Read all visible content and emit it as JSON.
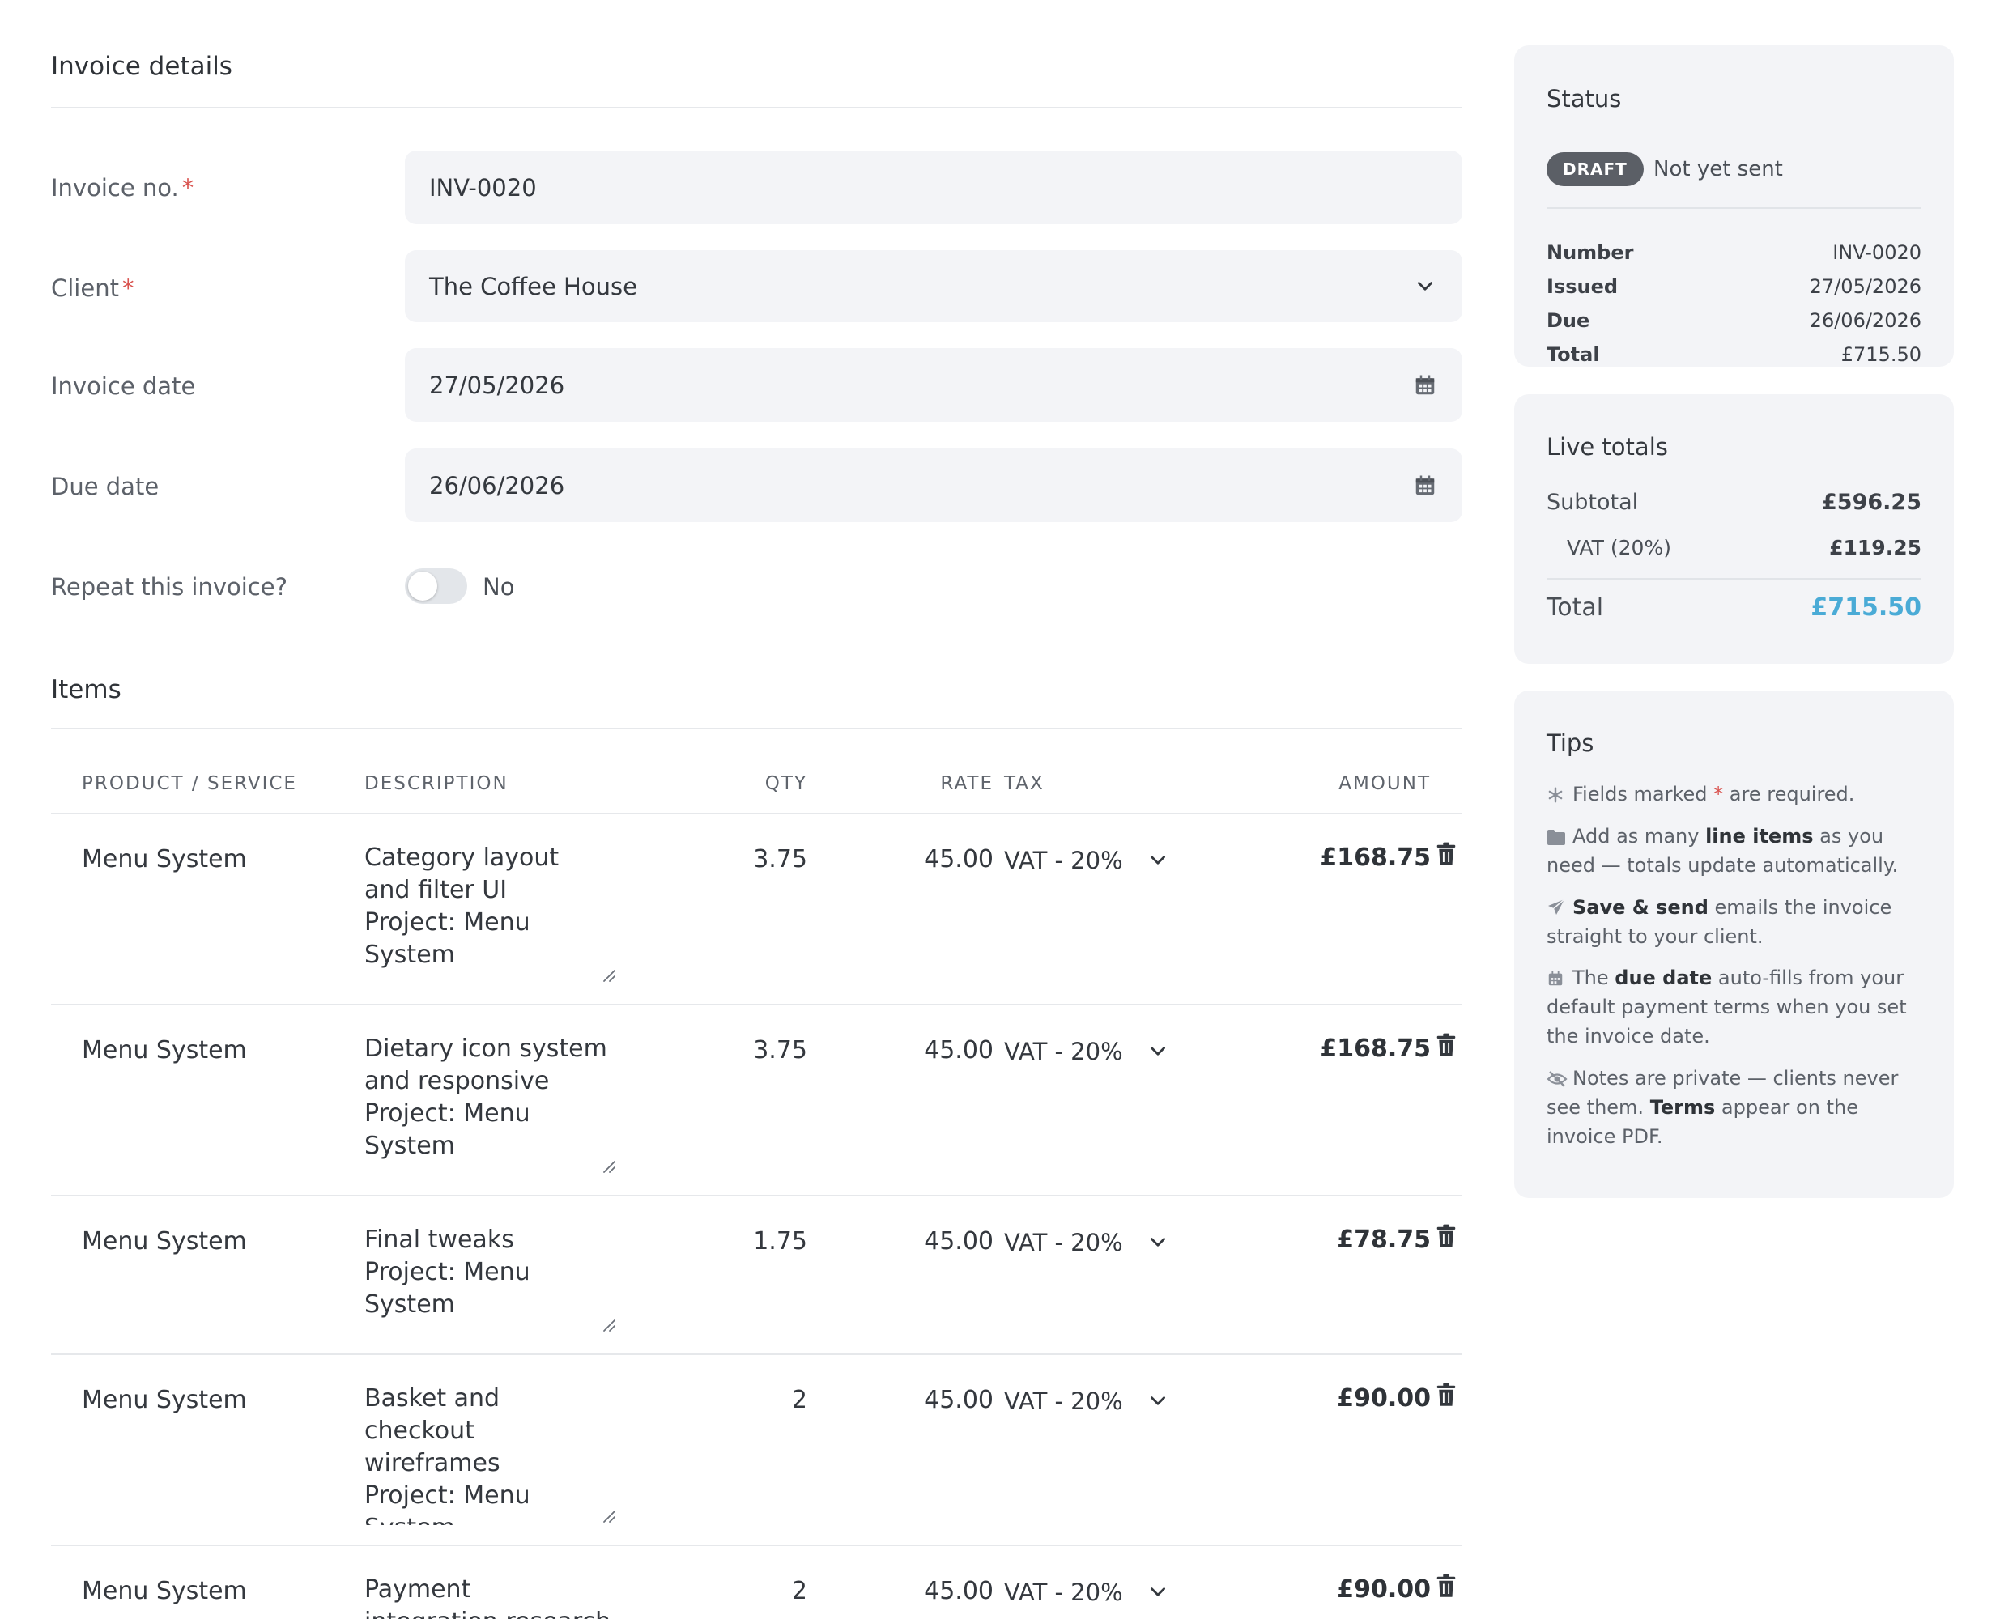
{
  "form": {
    "section_title": "Invoice details",
    "invoice_no": {
      "label": "Invoice no.",
      "required": "*",
      "value": "INV-0020"
    },
    "client": {
      "label": "Client",
      "required": "*",
      "value": "The Coffee House"
    },
    "invoice_date": {
      "label": "Invoice date",
      "value": "27/05/2026"
    },
    "due_date": {
      "label": "Due date",
      "value": "26/06/2026"
    },
    "repeat": {
      "label": "Repeat this invoice?",
      "value": "No"
    }
  },
  "items": {
    "section_title": "Items",
    "headers": {
      "product": "PRODUCT / SERVICE",
      "description": "DESCRIPTION",
      "qty": "QTY",
      "rate": "RATE",
      "tax": "TAX",
      "amount": "AMOUNT"
    },
    "rows": [
      {
        "product": "Menu System",
        "description": "Category layout and filter UI\nProject: Menu System",
        "qty": "3.75",
        "rate": "45.00",
        "tax": "VAT - 20%",
        "amount": "£168.75"
      },
      {
        "product": "Menu System",
        "description": "Dietary icon system and responsive\nProject: Menu System",
        "qty": "3.75",
        "rate": "45.00",
        "tax": "VAT - 20%",
        "amount": "£168.75"
      },
      {
        "product": "Menu System",
        "description": "Final tweaks\nProject: Menu System",
        "qty": "1.75",
        "rate": "45.00",
        "tax": "VAT - 20%",
        "amount": "£78.75"
      },
      {
        "product": "Menu System",
        "description": "Basket and checkout wireframes\nProject: Menu System",
        "qty": "2",
        "rate": "45.00",
        "tax": "VAT - 20%",
        "amount": "£90.00"
      },
      {
        "product": "Menu System",
        "description": "Payment integration research",
        "qty": "2",
        "rate": "45.00",
        "tax": "VAT - 20%",
        "amount": "£90.00"
      }
    ]
  },
  "status": {
    "title": "Status",
    "badge": "DRAFT",
    "note": "Not yet sent",
    "rows": [
      {
        "k": "Number",
        "v": "INV-0020"
      },
      {
        "k": "Issued",
        "v": "27/05/2026"
      },
      {
        "k": "Due",
        "v": "26/06/2026"
      },
      {
        "k": "Total",
        "v": "£715.50"
      }
    ]
  },
  "totals": {
    "title": "Live totals",
    "subtotal_label": "Subtotal",
    "subtotal": "£596.25",
    "vat_label": "VAT (20%)",
    "vat": "£119.25",
    "total_label": "Total",
    "total": "£715.50",
    "accent": "#4aabd6"
  },
  "tips": {
    "title": "Tips",
    "t1": {
      "a": "Fields marked ",
      "star": "*",
      "b": " are required."
    },
    "t2": {
      "a": "Add as many ",
      "b": "line items",
      "c": " as you need — totals update automatically."
    },
    "t3": {
      "b": "Save & send",
      "c": " emails the invoice straight to your client."
    },
    "t4": {
      "a": "The ",
      "b": "due date",
      "c": " auto-fills from your default payment terms when you set the invoice date."
    },
    "t5": {
      "a": "Notes are private — clients never see them. ",
      "b": "Terms",
      "c": " appear on the invoice PDF."
    }
  }
}
